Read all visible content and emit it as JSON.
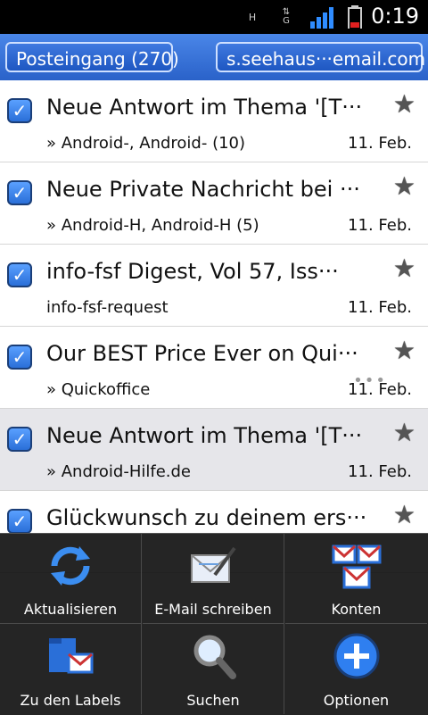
{
  "status_bar": {
    "time": "0:19",
    "network_h": "H",
    "network_g": "G"
  },
  "header": {
    "folder_label": "Posteingang (270)",
    "account_label": "s.seehaus···email.com"
  },
  "emails": [
    {
      "subject": "Neue Antwort im Thema '[T···",
      "from": "» Android-, Android- (10)",
      "date": "11. Feb."
    },
    {
      "subject": "Neue Private Nachricht bei ···",
      "from": "» Android-H, Android-H (5)",
      "date": "11. Feb."
    },
    {
      "subject": "info-fsf Digest, Vol 57, Iss···",
      "from": "info-fsf-request",
      "date": "11. Feb."
    },
    {
      "subject": "Our BEST Price Ever on Qui···",
      "from": "» Quickoffice",
      "date": "11. Feb."
    },
    {
      "subject": "Neue Antwort im Thema '[T···",
      "from": "» Android-Hilfe.de",
      "date": "11. Feb."
    },
    {
      "subject": "Glückwunsch zu deinem ers···",
      "from": "",
      "date": ""
    }
  ],
  "menu": {
    "refresh": "Aktualisieren",
    "compose": "E-Mail schreiben",
    "accounts": "Konten",
    "labels": "Zu den Labels",
    "search": "Suchen",
    "options": "Optionen"
  },
  "colors": {
    "accent": "#2a62c9",
    "checkbox": "#3a82ea",
    "menu_bg": "#141414"
  }
}
